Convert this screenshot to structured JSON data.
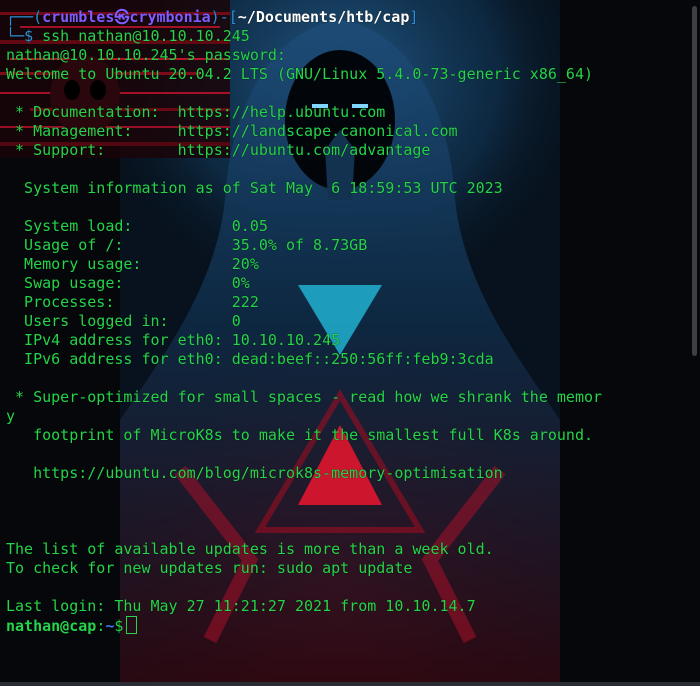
{
  "prompt": {
    "corner": "┌──(",
    "user": "crumbles",
    "at": "㉿",
    "host": "crymbonia",
    "mid": ")-[",
    "path": "~/Documents/htb/cap",
    "end": "]",
    "line2_prefix": "└─",
    "dollar": "$",
    "command": "ssh nathan@10.10.10.245"
  },
  "lines": [
    "nathan@10.10.10.245's password:",
    "Welcome to Ubuntu 20.04.2 LTS (GNU/Linux 5.4.0-73-generic x86_64)",
    "",
    " * Documentation:  https://help.ubuntu.com",
    " * Management:     https://landscape.canonical.com",
    " * Support:        https://ubuntu.com/advantage",
    "",
    "  System information as of Sat May  6 18:59:53 UTC 2023",
    "",
    "  System load:           0.05",
    "  Usage of /:            35.0% of 8.73GB",
    "  Memory usage:          20%",
    "  Swap usage:            0%",
    "  Processes:             222",
    "  Users logged in:       0",
    "  IPv4 address for eth0: 10.10.10.245",
    "  IPv6 address for eth0: dead:beef::250:56ff:feb9:3cda",
    "",
    " * Super-optimized for small spaces - read how we shrank the memor",
    "y",
    "   footprint of MicroK8s to make it the smallest full K8s around.",
    "",
    "   https://ubuntu.com/blog/microk8s-memory-optimisation",
    "",
    "",
    "",
    "The list of available updates is more than a week old.",
    "To check for new updates run: sudo apt update",
    "",
    "Last login: Thu May 27 11:21:27 2021 from 10.10.14.7"
  ],
  "final_prompt": {
    "user_host": "nathan@cap",
    "colon": ":",
    "path": "~",
    "dollar": "$"
  },
  "colors": {
    "text_green": "#25d448",
    "prompt_purple": "#7e5cff",
    "prompt_blue": "#2c8fd6",
    "background": "#05070b"
  }
}
